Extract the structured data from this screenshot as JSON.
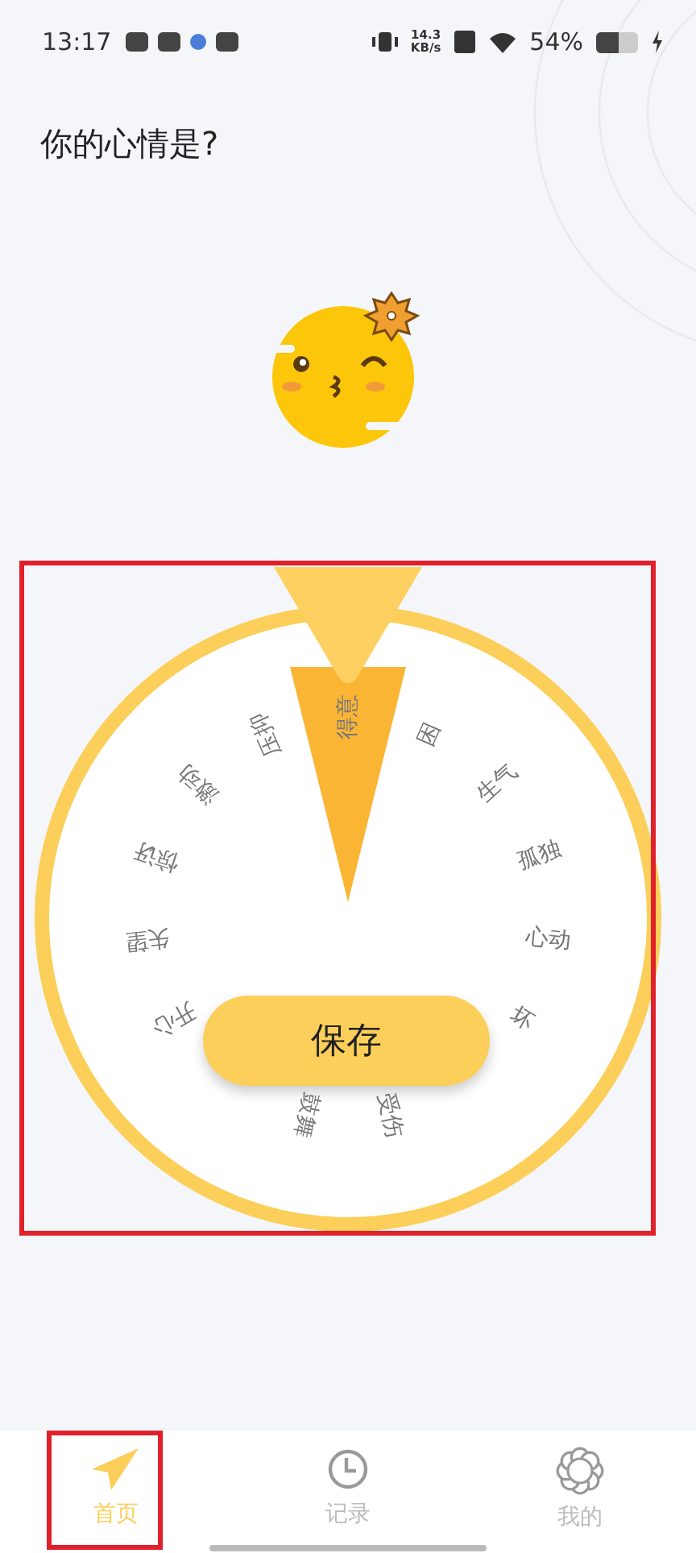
{
  "status_bar": {
    "time": "13:17",
    "net_speed_value": "14.3",
    "net_speed_unit": "KB/s",
    "battery": "54%"
  },
  "title": "你的心情是?",
  "wheel": {
    "labels": [
      {
        "text": "得意"
      },
      {
        "text": "困"
      },
      {
        "text": "生气"
      },
      {
        "text": "孤独"
      },
      {
        "text": "心动"
      },
      {
        "text": "坏"
      },
      {
        "text": "受伤"
      },
      {
        "text": "鼓舞"
      },
      {
        "text": "开心"
      },
      {
        "text": "失望"
      },
      {
        "text": "惊讶"
      },
      {
        "text": "激动"
      },
      {
        "text": "压抑"
      }
    ],
    "button": "保存"
  },
  "tabs": [
    {
      "label": "首页",
      "selected": true,
      "kind": "plane"
    },
    {
      "label": "记录",
      "selected": false,
      "kind": "clock"
    },
    {
      "label": "我的",
      "selected": false,
      "kind": "flower"
    }
  ]
}
